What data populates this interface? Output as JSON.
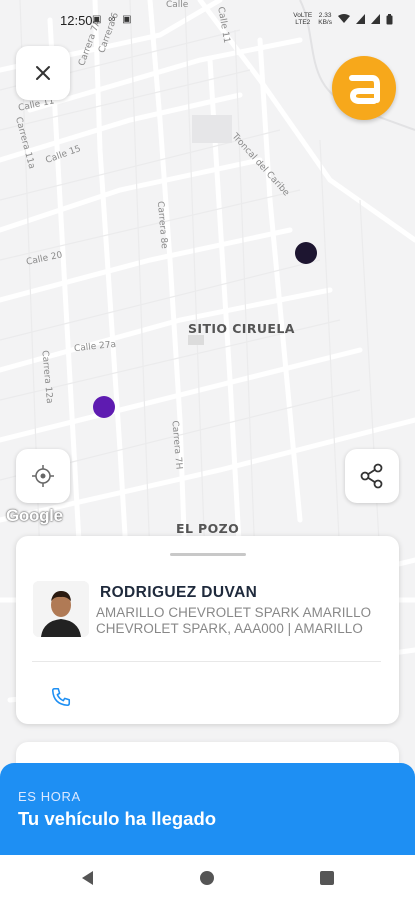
{
  "status_bar": {
    "time": "12:50",
    "left_icons": "▣ ∞ ▣",
    "network_top": "VoLTE",
    "network_bottom": "LTE2",
    "speed_top": "2.33",
    "speed_bottom": "KB/s"
  },
  "map": {
    "area_labels": {
      "sitio_ciruela": "SITIO CIRUELA",
      "el_pozo": "EL POZO"
    },
    "street_labels": {
      "calle_13": "Calle 13",
      "calle_15": "Calle 15",
      "calle_20": "Calle 20",
      "calle_27a": "Calle 27a",
      "carrera_11a": "Carrera 11a",
      "carrera_12a": "Carrera 12a",
      "carrera_6": "Carrera 6",
      "carrera_7a": "Carrera 7A",
      "carrera_8e": "Carrera 8e",
      "carrera_7h": "Carrera 7H",
      "troncal": "Troncal del Caribe",
      "calle_top": "Calle",
      "calle_11": "Calle 11",
      "calle_11b": "Calle 11"
    },
    "google_logo": "Google"
  },
  "icons": {
    "close": "close-icon",
    "brand": "brand-logo",
    "locate": "crosshair-icon",
    "share": "share-icon",
    "phone": "phone-icon"
  },
  "colors": {
    "brand": "#f7a81b",
    "banner": "#1e8ff3",
    "dot_dark": "#1d1530",
    "dot_purple": "#5e1bb1",
    "phone": "#1e8ff3"
  },
  "driver": {
    "name": "RODRIGUEZ DUVAN",
    "vehicle": "AMARILLO CHEVROLET SPARK AMARILLO CHEVROLET SPARK, AAA000 | AMARILLO"
  },
  "banner": {
    "kicker": "ES HORA",
    "title": "Tu vehículo ha llegado"
  }
}
